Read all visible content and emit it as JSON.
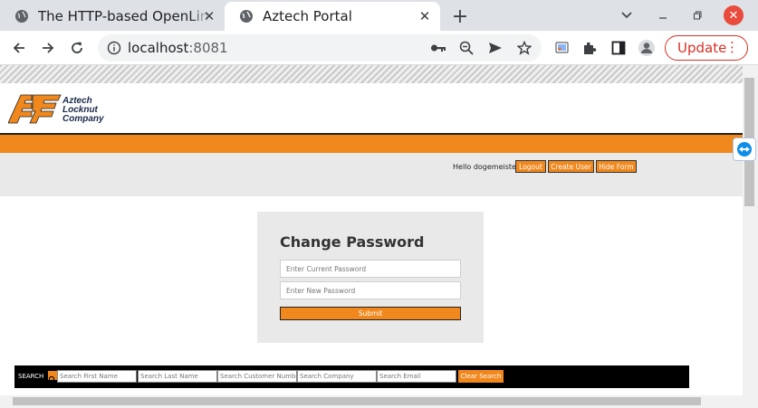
{
  "tabs": [
    {
      "title": "The HTTP-based OpenLink",
      "active": false
    },
    {
      "title": "Aztech Portal",
      "active": true
    }
  ],
  "address": {
    "host": "localhost",
    "port": ":8081"
  },
  "update_label": "Update",
  "logo": {
    "line1": "Aztech",
    "line2": "Locknut",
    "line3": "Company"
  },
  "header": {
    "hello_text": "Hello dogemeister",
    "logout": "Logout",
    "create_user": "Create User",
    "hide_form": "Hide Form"
  },
  "change_password": {
    "title": "Change Password",
    "current_placeholder": "Enter Current Password",
    "new_placeholder": "Enter New Password",
    "submit": "Submit"
  },
  "search": {
    "label": "SEARCH",
    "first_name": "Search First Name",
    "last_name": "Search Last Name",
    "customer_number": "Search Customer Number",
    "company": "Search Company",
    "email": "Search Email",
    "clear": "Clear Search"
  },
  "colors": {
    "accent": "#f0881e",
    "update_red": "#d93025"
  }
}
